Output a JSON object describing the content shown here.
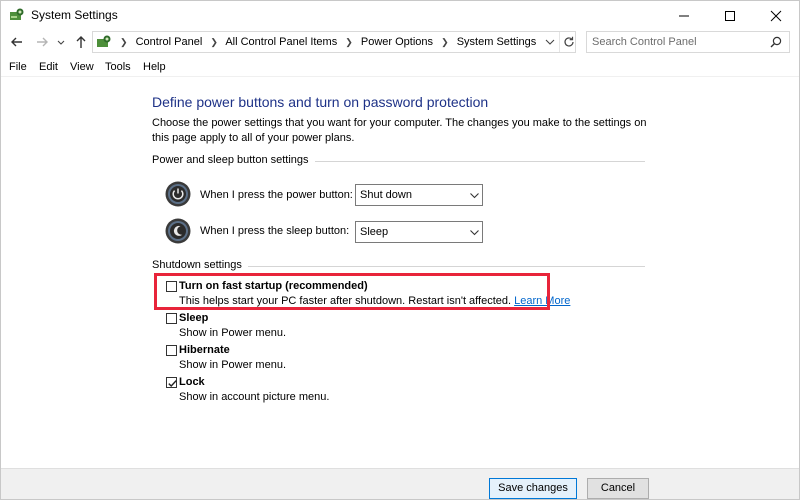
{
  "window": {
    "title": "System Settings"
  },
  "address_bar": {
    "breadcrumbs": [
      "Control Panel",
      "All Control Panel Items",
      "Power Options",
      "System Settings"
    ],
    "search_placeholder": "Search Control Panel"
  },
  "menu": [
    "File",
    "Edit",
    "View",
    "Tools",
    "Help"
  ],
  "page": {
    "title": "Define power buttons and turn on password protection",
    "description": "Choose the power settings that you want for your computer. The changes you make to the settings on this page apply to all of your power plans."
  },
  "power_sleep": {
    "heading": "Power and sleep button settings",
    "power_button": {
      "label": "When I press the power button:",
      "value": "Shut down"
    },
    "sleep_button": {
      "label": "When I press the sleep button:",
      "value": "Sleep"
    }
  },
  "shutdown": {
    "heading": "Shutdown settings",
    "options": [
      {
        "label": "Turn on fast startup (recommended)",
        "desc": "This helps start your PC faster after shutdown. Restart isn't affected.",
        "link": "Learn More",
        "checked": false
      },
      {
        "label": "Sleep",
        "desc": "Show in Power menu.",
        "checked": false
      },
      {
        "label": "Hibernate",
        "desc": "Show in Power menu.",
        "checked": false
      },
      {
        "label": "Lock",
        "desc": "Show in account picture menu.",
        "checked": true
      }
    ]
  },
  "footer": {
    "save": "Save changes",
    "cancel": "Cancel"
  },
  "colors": {
    "title": "#1e3287",
    "link": "#0066cc",
    "highlight": "#e8243a"
  },
  "icons": [
    "control-panel-icon",
    "minimize-icon",
    "maximize-icon",
    "close-icon",
    "back-arrow-icon",
    "forward-arrow-icon",
    "up-arrow-icon",
    "refresh-icon",
    "search-icon",
    "power-button-icon",
    "sleep-button-icon",
    "chevron-down-icon",
    "checkmark-icon"
  ]
}
